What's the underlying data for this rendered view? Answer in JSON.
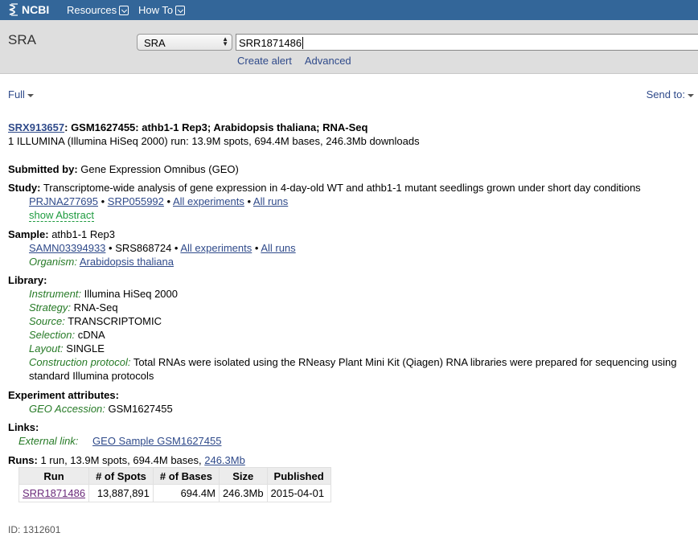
{
  "nav": {
    "logo_text": "NCBI",
    "resources_label": "Resources",
    "howto_label": "How To"
  },
  "search": {
    "db_title": "SRA",
    "db_selected": "SRA",
    "term_value": "SRR1871486",
    "create_alert": "Create alert",
    "advanced": "Advanced"
  },
  "display": {
    "format_label": "Full",
    "send_to_label": "Send to:"
  },
  "record": {
    "accession": "SRX913657",
    "title": ": GSM1627455: athb1-1 Rep3; Arabidopsis thaliana; RNA-Seq",
    "summary": "1 ILLUMINA (Illumina HiSeq 2000) run: 13.9M spots, 694.4M bases, 246.3Mb downloads",
    "submitted_by_label": "Submitted by:",
    "submitted_by_value": " Gene Expression Omnibus (GEO)",
    "study_label": "Study:",
    "study_value": " Transcriptome-wide analysis of gene expression in 4-day-old WT and athb1-1 mutant seedlings grown under short day conditions",
    "study_bioproject": "PRJNA277695",
    "study_srp": "SRP055992",
    "study_all_experiments": "All experiments",
    "study_all_runs": "All runs",
    "show_abstract": "show Abstract",
    "sample_label": "Sample:",
    "sample_value": " athb1-1 Rep3",
    "sample_biosample": "SAMN03394933",
    "sample_srs": "SRS868724",
    "sample_all_experiments": "All experiments",
    "sample_all_runs": "All runs",
    "organism_label": "Organism:",
    "organism_value": "Arabidopsis thaliana",
    "library_label": "Library:",
    "instrument_label": "Instrument:",
    "instrument_value": " Illumina HiSeq 2000",
    "strategy_label": "Strategy:",
    "strategy_value": " RNA-Seq",
    "source_label": "Source:",
    "source_value": " TRANSCRIPTOMIC",
    "selection_label": "Selection:",
    "selection_value": " cDNA",
    "layout_label": "Layout:",
    "layout_value": " SINGLE",
    "protocol_label": "Construction protocol:",
    "protocol_value_line1": " Total RNAs were isolated using the RNeasy Plant Mini Kit (Qiagen) RNA libraries were prepared for sequencing using",
    "protocol_value_line2": "standard Illumina protocols",
    "exp_attr_label": "Experiment attributes:",
    "geo_acc_label": "GEO Accession:",
    "geo_acc_value": " GSM1627455",
    "links_label": "Links:",
    "external_link_label": "External link:",
    "external_link_value": "GEO Sample GSM1627455",
    "runs_label": "Runs:",
    "runs_summary": " 1 run, 13.9M spots, 694.4M bases, ",
    "runs_size_link": "246.3Mb",
    "id_text": "ID: 1312601"
  },
  "runs_table": {
    "headers": [
      "Run",
      "# of Spots",
      "# of Bases",
      "Size",
      "Published"
    ],
    "row": [
      "SRR1871486",
      "13,887,891",
      "694.4M",
      "246.3Mb",
      "2015-04-01"
    ]
  },
  "colors": {
    "nav_bg": "#336699",
    "link": "#2f4a8a",
    "green_label": "#267a26"
  }
}
